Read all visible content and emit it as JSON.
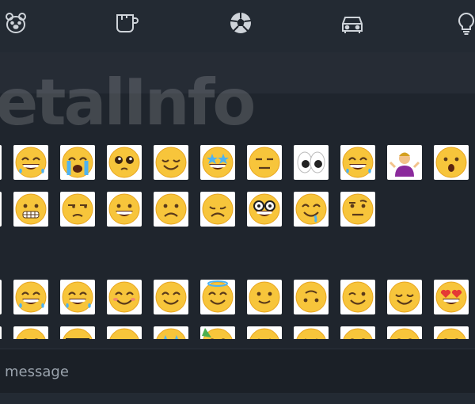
{
  "categories": [
    {
      "name": "animals",
      "icon": "bear-face-icon"
    },
    {
      "name": "food",
      "icon": "coffee-cup-icon"
    },
    {
      "name": "activity",
      "icon": "soccer-ball-icon"
    },
    {
      "name": "travel",
      "icon": "car-icon"
    },
    {
      "name": "objects",
      "icon": "light-bulb-icon"
    }
  ],
  "watermark": "etalInfo",
  "emoji_sections": [
    {
      "rows": [
        [
          "sunglasses-face",
          "joy-face",
          "loudly-crying-face",
          "pleading-face",
          "relieved-face",
          "star-struck-face",
          "expressionless-face",
          "eyes",
          "rofl-face",
          "person-shrugging",
          "hushed-face"
        ],
        [
          "screaming-face",
          "grimacing-face",
          "unamused-face",
          "grinning-face",
          "frowning-face",
          "disappointed-face",
          "nerd-face",
          "drooling-face",
          "raised-eyebrow-face"
        ]
      ]
    },
    {
      "rows": [
        [
          "grinning-sweat-face",
          "joy-face",
          "rofl-face",
          "blushing-smile-face",
          "smiling-eyes-face",
          "halo-face",
          "slightly-smiling-face",
          "upside-down-face",
          "winking-face",
          "relieved-face",
          "heart-eyes-face"
        ],
        [
          "grin-face",
          "laughing-face",
          "sunglasses-face",
          "smirk-face",
          "star-struck-face",
          "party-face",
          "neutral-face",
          "kissing-face",
          "smile-face",
          "smile-face",
          "smile-face"
        ]
      ]
    }
  ],
  "message": {
    "placeholder": "message",
    "value": ""
  }
}
